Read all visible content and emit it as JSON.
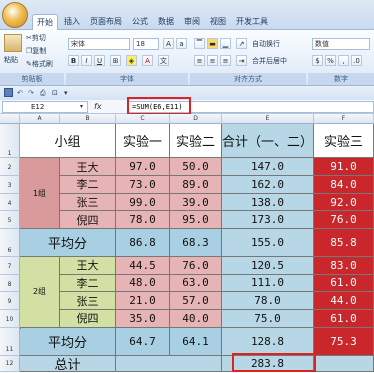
{
  "ribbon": {
    "tabs": [
      "开始",
      "插入",
      "页面布局",
      "公式",
      "数据",
      "审阅",
      "视图",
      "开发工具"
    ],
    "clipboard": {
      "cut": "剪切",
      "copy": "复制",
      "paste": "粘贴",
      "format_painter": "格式刷",
      "group": "剪贴板"
    },
    "font": {
      "name": "宋体",
      "size": "18",
      "group": "字体"
    },
    "alignment": {
      "wrap": "自动换行",
      "merge": "合并后居中",
      "group": "对齐方式"
    },
    "number": {
      "format": "数值",
      "group": "数字"
    }
  },
  "formula_bar": {
    "cell_ref": "E12",
    "fx": "fx",
    "formula": "=SUM(E6,E11)"
  },
  "columns": [
    "A",
    "B",
    "C",
    "D",
    "E",
    "F"
  ],
  "rows": [
    "1",
    "2",
    "3",
    "4",
    "5",
    "6",
    "7",
    "8",
    "9",
    "10",
    "11",
    "12"
  ],
  "sheet": {
    "header": {
      "group": "小组",
      "exp1": "实验一",
      "exp2": "实验二",
      "total": "合计（一、二）",
      "exp3": "实验三"
    },
    "group1": {
      "label": "1组",
      "members": [
        {
          "name": "王大",
          "exp1": "97.0",
          "exp2": "50.0",
          "total": "147.0",
          "exp3": "91.0"
        },
        {
          "name": "李二",
          "exp1": "73.0",
          "exp2": "89.0",
          "total": "162.0",
          "exp3": "84.0"
        },
        {
          "name": "张三",
          "exp1": "99.0",
          "exp2": "39.0",
          "total": "138.0",
          "exp3": "92.0"
        },
        {
          "name": "倪四",
          "exp1": "78.0",
          "exp2": "95.0",
          "total": "173.0",
          "exp3": "76.0"
        }
      ],
      "avg": {
        "label": "平均分",
        "exp1": "86.8",
        "exp2": "68.3",
        "total": "155.0",
        "exp3": "85.8"
      }
    },
    "group2": {
      "label": "2组",
      "members": [
        {
          "name": "王大",
          "exp1": "44.5",
          "exp2": "76.0",
          "total": "120.5",
          "exp3": "83.0"
        },
        {
          "name": "李二",
          "exp1": "48.0",
          "exp2": "63.0",
          "total": "111.0",
          "exp3": "61.0"
        },
        {
          "name": "张三",
          "exp1": "21.0",
          "exp2": "57.0",
          "total": "78.0",
          "exp3": "44.0"
        },
        {
          "name": "倪四",
          "exp1": "35.0",
          "exp2": "40.0",
          "total": "75.0",
          "exp3": "61.0"
        }
      ],
      "avg": {
        "label": "平均分",
        "exp1": "64.7",
        "exp2": "64.1",
        "total": "128.8",
        "exp3": "75.3"
      }
    },
    "sum": {
      "label": "总计",
      "value": "283.8"
    }
  }
}
